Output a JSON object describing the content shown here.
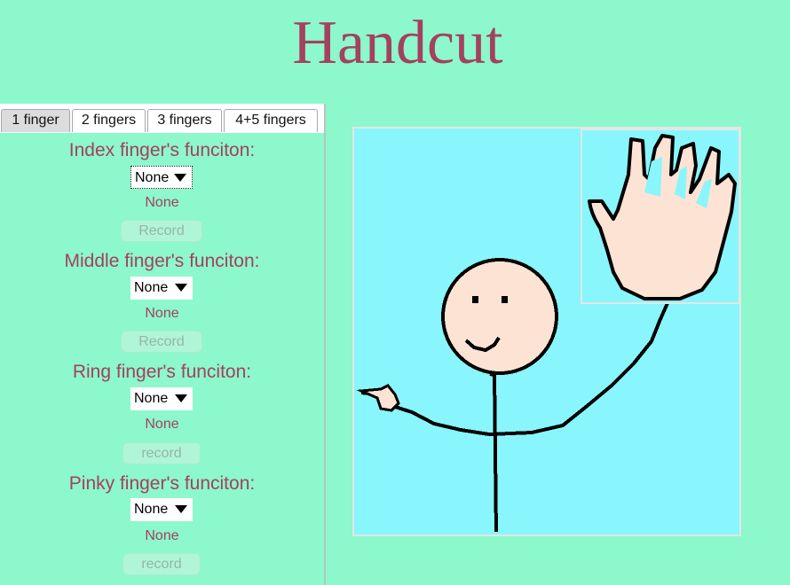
{
  "app": {
    "title": "Handcut"
  },
  "tabs": [
    {
      "label": "1 finger",
      "active": true
    },
    {
      "label": "2 fingers",
      "active": false
    },
    {
      "label": "3 fingers",
      "active": false
    },
    {
      "label": "4+5 fingers",
      "active": false
    }
  ],
  "fingers": [
    {
      "label": "Index finger's funciton:",
      "select_value": "None",
      "current": "None",
      "button": "Record"
    },
    {
      "label": "Middle finger's funciton:",
      "select_value": "None",
      "current": "None",
      "button": "Record"
    },
    {
      "label": "Ring finger's funciton:",
      "select_value": "None",
      "current": "None",
      "button": "record"
    },
    {
      "label": "Pinky finger's funciton:",
      "select_value": "None",
      "current": "None",
      "button": "record"
    }
  ],
  "colors": {
    "background": "#8cf8cc",
    "accent": "#a3415f",
    "canvas": "#88f6fc",
    "skin": "#fde3d4"
  },
  "illustration": {
    "subject": "stick-figure-waving",
    "icons": [
      "stick-figure-icon",
      "hand-icon"
    ]
  }
}
